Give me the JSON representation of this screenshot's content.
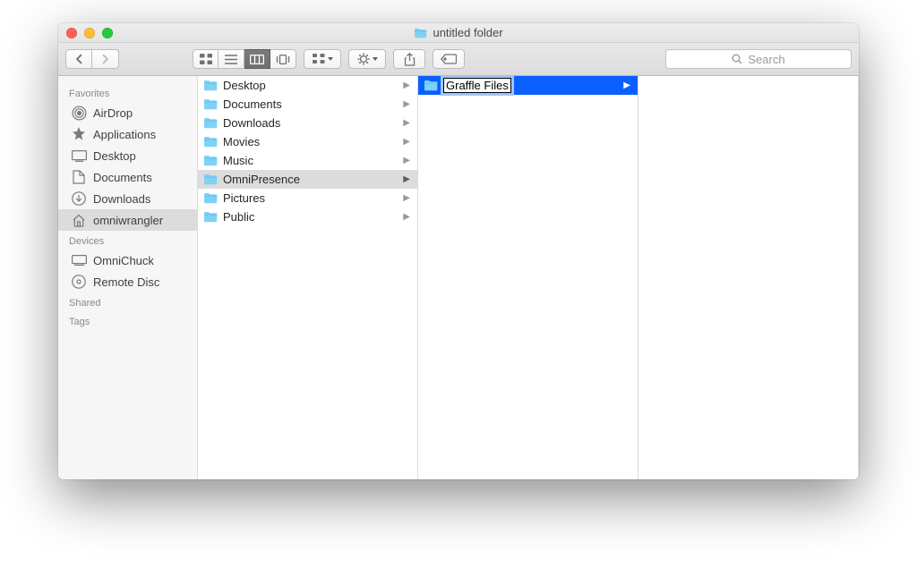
{
  "window": {
    "title": "untitled folder"
  },
  "search": {
    "placeholder": "Search"
  },
  "sidebar": {
    "sections": [
      {
        "title": "Favorites",
        "items": [
          {
            "icon": "airdrop",
            "label": "AirDrop"
          },
          {
            "icon": "app",
            "label": "Applications"
          },
          {
            "icon": "desktop",
            "label": "Desktop"
          },
          {
            "icon": "doc",
            "label": "Documents"
          },
          {
            "icon": "download",
            "label": "Downloads"
          },
          {
            "icon": "home",
            "label": "omniwrangler",
            "selected": true
          }
        ]
      },
      {
        "title": "Devices",
        "items": [
          {
            "icon": "computer",
            "label": "OmniChuck"
          },
          {
            "icon": "disc",
            "label": "Remote Disc"
          }
        ]
      },
      {
        "title": "Shared",
        "items": []
      },
      {
        "title": "Tags",
        "items": []
      }
    ]
  },
  "col1": {
    "items": [
      {
        "label": "Desktop"
      },
      {
        "label": "Documents"
      },
      {
        "label": "Downloads"
      },
      {
        "label": "Movies"
      },
      {
        "label": "Music"
      },
      {
        "label": "OmniPresence",
        "selected": true
      },
      {
        "label": "Pictures"
      },
      {
        "label": "Public"
      }
    ]
  },
  "col2": {
    "items": [
      {
        "label": "Graffle Files",
        "selected": true,
        "renaming": true
      }
    ]
  }
}
